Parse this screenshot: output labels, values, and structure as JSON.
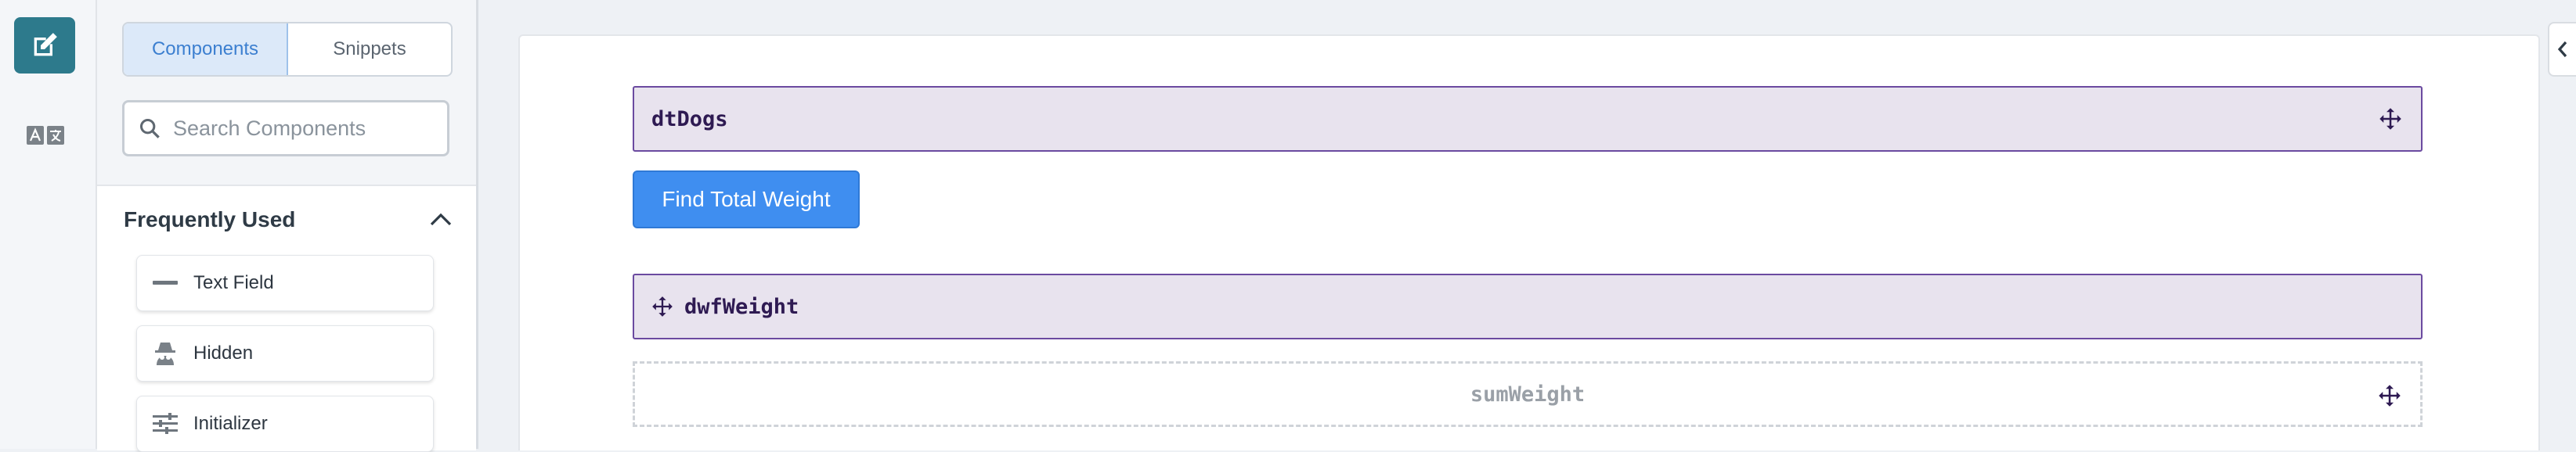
{
  "rail": {
    "edit_icon": "edit-icon",
    "translate_icon": "translate-icon",
    "accent": "#2d7a8c"
  },
  "panel": {
    "tabs": [
      {
        "label": "Components",
        "active": true
      },
      {
        "label": "Snippets",
        "active": false
      }
    ],
    "search_placeholder": "Search Components",
    "section": {
      "title": "Frequently Used",
      "items": [
        {
          "label": "Text Field",
          "icon": "minus-icon"
        },
        {
          "label": "Hidden",
          "icon": "incognito-icon"
        },
        {
          "label": "Initializer",
          "icon": "sliders-icon"
        }
      ]
    }
  },
  "canvas": {
    "components": {
      "table": "dtDogs",
      "button": "Find Total Weight",
      "data_field": "dwfWeight",
      "sum_field": "sumWeight"
    },
    "accent": "#6b4aa0",
    "button_color": "#3f8ef0"
  }
}
